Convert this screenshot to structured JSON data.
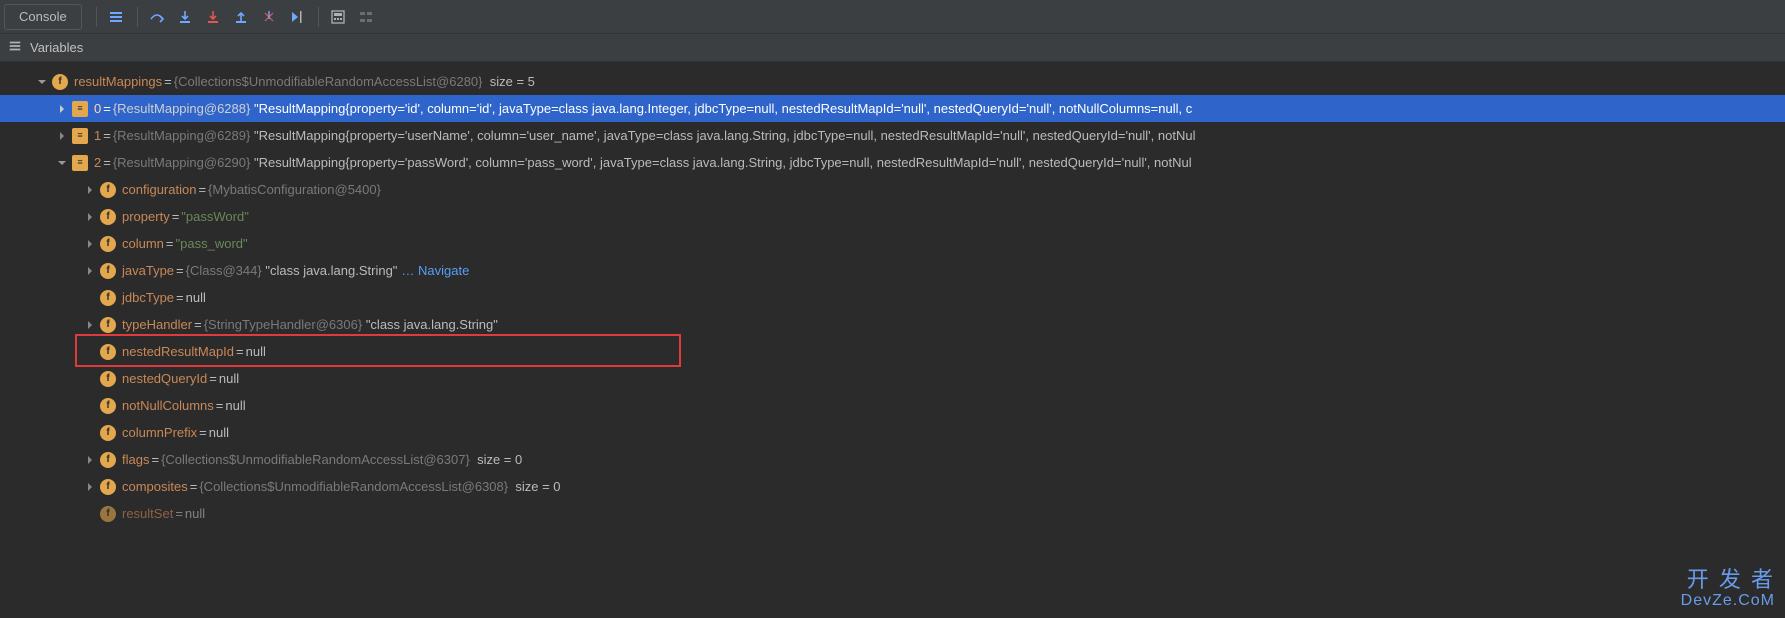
{
  "toolbar": {
    "console_label": "Console"
  },
  "panel": {
    "title": "Variables"
  },
  "tree": {
    "root": {
      "name": "resultMappings",
      "obj": "{Collections$UnmodifiableRandomAccessList@6280}",
      "size": "size = 5"
    },
    "item0": {
      "idx": "0",
      "obj": "{ResultMapping@6288}",
      "val": "\"ResultMapping{property='id', column='id', javaType=class java.lang.Integer, jdbcType=null, nestedResultMapId='null', nestedQueryId='null', notNullColumns=null, c"
    },
    "item1": {
      "idx": "1",
      "obj": "{ResultMapping@6289}",
      "val": "\"ResultMapping{property='userName', column='user_name', javaType=class java.lang.String, jdbcType=null, nestedResultMapId='null', nestedQueryId='null', notNul"
    },
    "item2": {
      "idx": "2",
      "obj": "{ResultMapping@6290}",
      "val": "\"ResultMapping{property='passWord', column='pass_word', javaType=class java.lang.String, jdbcType=null, nestedResultMapId='null', nestedQueryId='null', notNul"
    },
    "fields": {
      "configuration": {
        "name": "configuration",
        "obj": "{MybatisConfiguration@5400}"
      },
      "property": {
        "name": "property",
        "val": "\"passWord\""
      },
      "column": {
        "name": "column",
        "val": "\"pass_word\""
      },
      "javaType": {
        "name": "javaType",
        "obj": "{Class@344}",
        "val": "\"class java.lang.String\"",
        "nav": "… Navigate"
      },
      "jdbcType": {
        "name": "jdbcType",
        "val": "null"
      },
      "typeHandler": {
        "name": "typeHandler",
        "obj": "{StringTypeHandler@6306}",
        "val": "\"class java.lang.String\""
      },
      "nestedResultMapId": {
        "name": "nestedResultMapId",
        "val": "null"
      },
      "nestedQueryId": {
        "name": "nestedQueryId",
        "val": "null"
      },
      "notNullColumns": {
        "name": "notNullColumns",
        "val": "null"
      },
      "columnPrefix": {
        "name": "columnPrefix",
        "val": "null"
      },
      "flags": {
        "name": "flags",
        "obj": "{Collections$UnmodifiableRandomAccessList@6307}",
        "size": "size = 0"
      },
      "composites": {
        "name": "composites",
        "obj": "{Collections$UnmodifiableRandomAccessList@6308}",
        "size": "size = 0"
      },
      "resultSet": {
        "name": "resultSet",
        "val": "null"
      }
    }
  },
  "watermark": {
    "cn": "开 发 者",
    "en": "DevZe.CoM"
  }
}
